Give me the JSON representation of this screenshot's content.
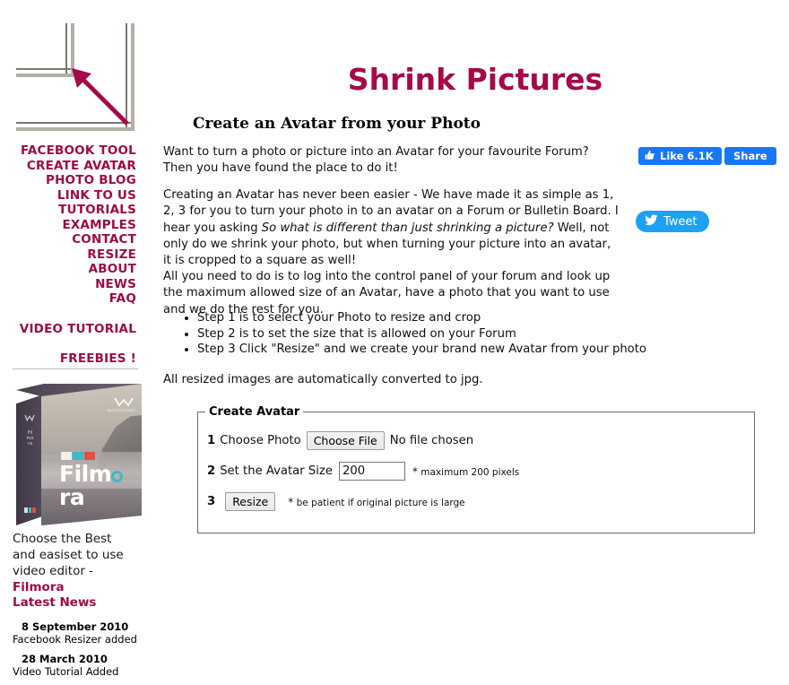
{
  "colors": {
    "accent_crimson": "#a50a4a",
    "nav_crimson": "#9e0b44",
    "facebook_blue": "#1877f2",
    "twitter_blue": "#1da1f2",
    "filmora_teal": "#3fb7c6",
    "filmora_red": "#e2513e"
  },
  "logo": {
    "icon": "shrink-corner-arrow-icon"
  },
  "sidebar": {
    "nav": [
      {
        "label": "FACEBOOK TOOL"
      },
      {
        "label": "CREATE AVATAR"
      },
      {
        "label": "PHOTO BLOG"
      },
      {
        "label": "LINK TO US"
      },
      {
        "label": "TUTORIALS"
      },
      {
        "label": "EXAMPLES"
      },
      {
        "label": "CONTACT"
      },
      {
        "label": "RESIZE"
      },
      {
        "label": "ABOUT"
      },
      {
        "label": "NEWS"
      },
      {
        "label": "FAQ"
      },
      {
        "label": "VIDEO TUTORIAL"
      },
      {
        "label": "FREEBIES !"
      }
    ],
    "promo": {
      "box_word": "Film",
      "box_word_end": "ra",
      "spine_text": "Filmora",
      "brand_small": "wondershare",
      "caption_line1": "Choose the Best",
      "caption_line2": "and easiset to use",
      "caption_line3": "video editor -",
      "brand": "Filmora"
    },
    "news": {
      "title": "Latest News",
      "items": [
        {
          "date": "8 September 2010",
          "text": "Facebook Resizer added"
        },
        {
          "date": "28 March 2010",
          "text": "Video Tutorial Added"
        }
      ]
    }
  },
  "main": {
    "title": "Shrink Pictures",
    "subtitle": "Create an Avatar from your Photo",
    "para1": "Want to turn a photo or picture into an Avatar for your favourite Forum? Then you have found the place to do it!",
    "para2_a": "Creating an Avatar has never been easier - We have made it as simple as 1, 2, 3 for you to turn your photo in to an avatar on a Forum or Bulletin Board. I hear you asking ",
    "para2_italic": "So what is different than just shrinking a picture?",
    "para2_b": "  Well, not only do we shrink your photo, but when turning your picture into an avatar, it is cropped to a square as well!",
    "para3": "All you need to do is to log into the control panel of your forum and look up the maximum allowed size of an Avatar, have a photo that you want to use and we do the rest for you.",
    "steps": [
      "Step 1 is to select your Photo to resize and crop",
      "Step 2 is to set the size that is allowed on your Forum",
      "Step 3 Click \"Resize\" and we create your brand new Avatar from your photo"
    ],
    "para4": "All resized images are automatically converted to jpg."
  },
  "social": {
    "facebook_like_label": "Like 6.1K",
    "facebook_share_label": "Share",
    "twitter_label": "Tweet"
  },
  "form": {
    "legend": "Create Avatar",
    "step1_num": "1",
    "step1_label": "Choose Photo",
    "choose_file_button": "Choose File",
    "no_file_text": "No file chosen",
    "step2_num": "2",
    "step2_label": "Set the Avatar Size",
    "size_value": "200",
    "size_hint_star": "*",
    "size_hint": "maximum 200 pixels",
    "step3_num": "3",
    "resize_button": "Resize",
    "resize_hint_star": "*",
    "resize_hint": "be patient if original picture is large"
  }
}
